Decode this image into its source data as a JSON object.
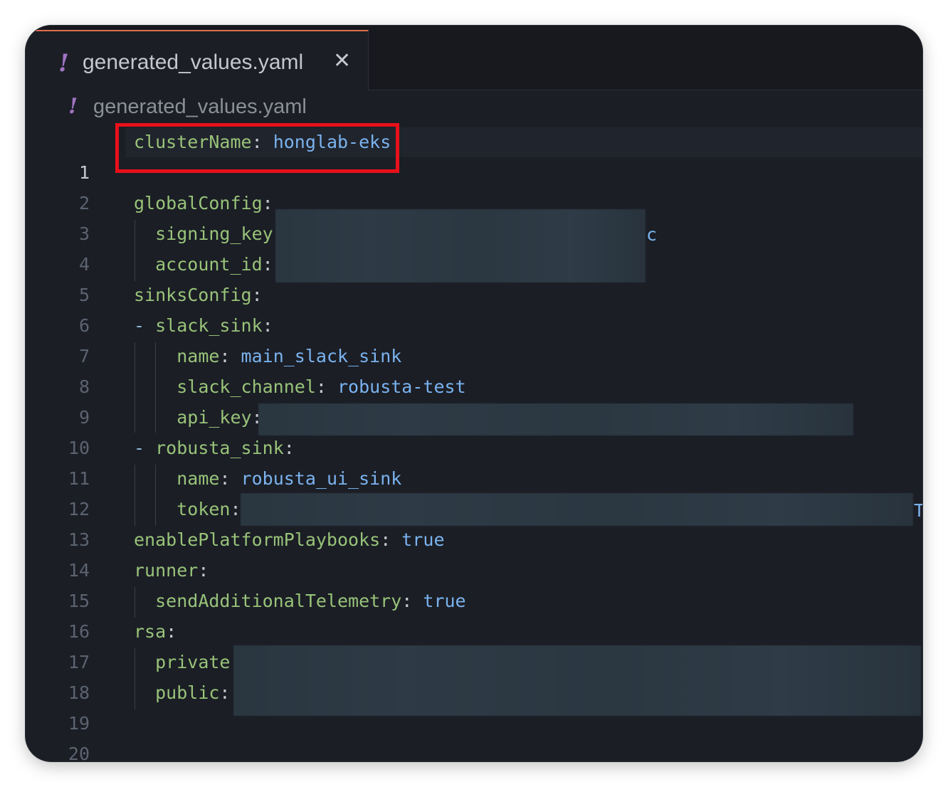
{
  "tab": {
    "icon": "!",
    "label": "generated_values.yaml",
    "close": "✕"
  },
  "breadcrumb": {
    "icon": "!",
    "label": "generated_values.yaml"
  },
  "lines": [
    {
      "n": "1",
      "key": "clusterName",
      "value": "honglab-eks"
    },
    {
      "n": "2"
    },
    {
      "n": "3",
      "key": "globalConfig"
    },
    {
      "n": "4",
      "key": "signing_key",
      "tail": "c"
    },
    {
      "n": "5",
      "key": "account_id"
    },
    {
      "n": "6",
      "key": "sinksConfig"
    },
    {
      "n": "7",
      "key": "slack_sink"
    },
    {
      "n": "8",
      "key": "name",
      "value": "main_slack_sink"
    },
    {
      "n": "9",
      "key": "slack_channel",
      "value": "robusta-test"
    },
    {
      "n": "10",
      "key": "api_key"
    },
    {
      "n": "11",
      "key": "robusta_sink"
    },
    {
      "n": "12",
      "key": "name",
      "value": "robusta_ui_sink"
    },
    {
      "n": "13",
      "key": "token",
      "tail": "T"
    },
    {
      "n": "14",
      "key": "enablePlatformPlaybooks",
      "value": "true"
    },
    {
      "n": "15",
      "key": "runner"
    },
    {
      "n": "16",
      "key": "sendAdditionalTelemetry",
      "value": "true"
    },
    {
      "n": "17",
      "key": "rsa"
    },
    {
      "n": "18",
      "key": "private"
    },
    {
      "n": "19",
      "key": "public"
    },
    {
      "n": "20"
    }
  ]
}
